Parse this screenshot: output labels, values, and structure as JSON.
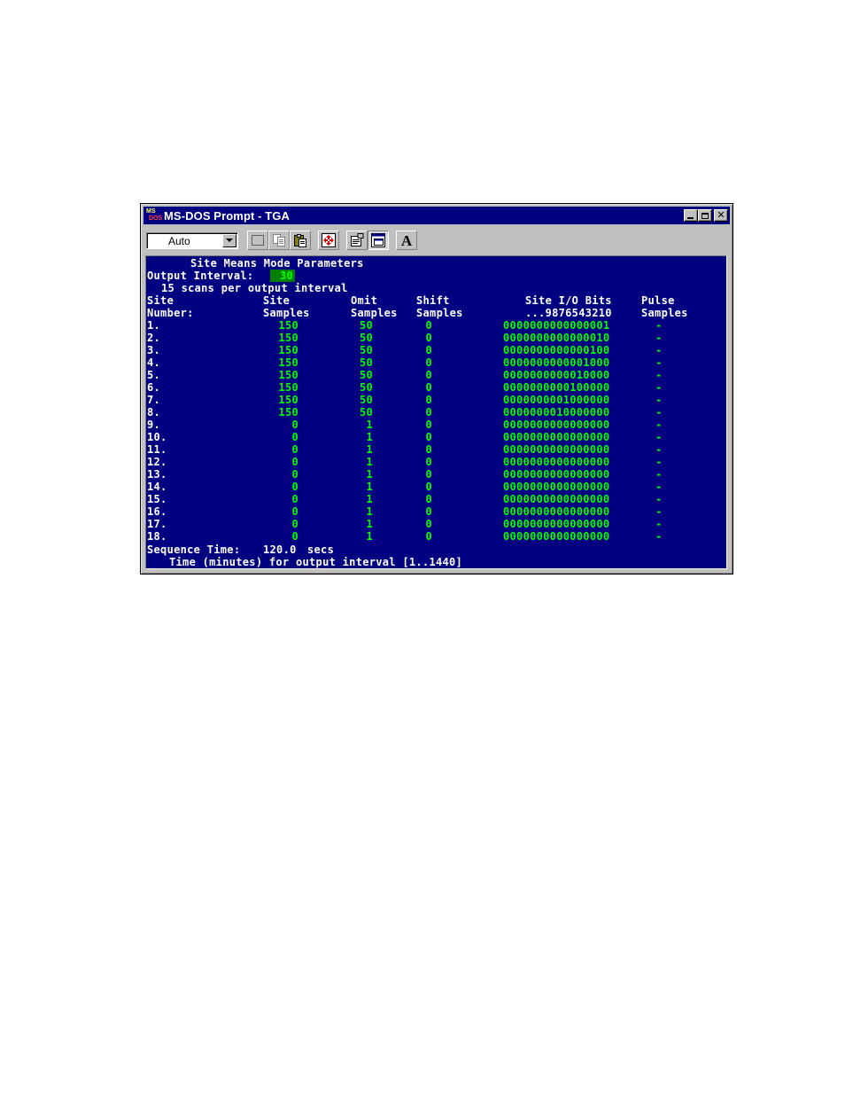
{
  "window": {
    "title": "MS-DOS Prompt - TGA",
    "icon_text_top": "MS",
    "icon_text_bottom": "DOS"
  },
  "toolbar": {
    "font_size_value": "Auto",
    "buttons": [
      "mark-icon",
      "copy-icon",
      "paste-icon",
      "fullscreen-icon",
      "properties-icon",
      "background-icon",
      "font-icon"
    ],
    "font_button_label": "A"
  },
  "console": {
    "heading": "Site Means Mode Parameters",
    "output_interval_label": "Output Interval:",
    "output_interval_value": "30",
    "scans_line": "15 scans per output interval",
    "headers": {
      "site_1": "Site",
      "site_2": "Number:",
      "site_samples_1": "Site",
      "site_samples_2": "Samples",
      "omit_1": "Omit",
      "omit_2": "Samples",
      "shift_1": "Shift",
      "shift_2": "Samples",
      "io_1": "Site I/O Bits",
      "io_2": "...9876543210",
      "pulse_1": "Pulse",
      "pulse_2": "Samples"
    },
    "rows": [
      {
        "site": "1.",
        "samples": "150",
        "omit": "50",
        "shift": "0",
        "bits": "0000000000000001",
        "pulse": "-"
      },
      {
        "site": "2.",
        "samples": "150",
        "omit": "50",
        "shift": "0",
        "bits": "0000000000000010",
        "pulse": "-"
      },
      {
        "site": "3.",
        "samples": "150",
        "omit": "50",
        "shift": "0",
        "bits": "0000000000000100",
        "pulse": "-"
      },
      {
        "site": "4.",
        "samples": "150",
        "omit": "50",
        "shift": "0",
        "bits": "0000000000001000",
        "pulse": "-"
      },
      {
        "site": "5.",
        "samples": "150",
        "omit": "50",
        "shift": "0",
        "bits": "0000000000010000",
        "pulse": "-"
      },
      {
        "site": "6.",
        "samples": "150",
        "omit": "50",
        "shift": "0",
        "bits": "0000000000100000",
        "pulse": "-"
      },
      {
        "site": "7.",
        "samples": "150",
        "omit": "50",
        "shift": "0",
        "bits": "0000000001000000",
        "pulse": "-"
      },
      {
        "site": "8.",
        "samples": "150",
        "omit": "50",
        "shift": "0",
        "bits": "0000000010000000",
        "pulse": "-"
      },
      {
        "site": "9.",
        "samples": "0",
        "omit": "1",
        "shift": "0",
        "bits": "0000000000000000",
        "pulse": "-"
      },
      {
        "site": "10.",
        "samples": "0",
        "omit": "1",
        "shift": "0",
        "bits": "0000000000000000",
        "pulse": "-"
      },
      {
        "site": "11.",
        "samples": "0",
        "omit": "1",
        "shift": "0",
        "bits": "0000000000000000",
        "pulse": "-"
      },
      {
        "site": "12.",
        "samples": "0",
        "omit": "1",
        "shift": "0",
        "bits": "0000000000000000",
        "pulse": "-"
      },
      {
        "site": "13.",
        "samples": "0",
        "omit": "1",
        "shift": "0",
        "bits": "0000000000000000",
        "pulse": "-"
      },
      {
        "site": "14.",
        "samples": "0",
        "omit": "1",
        "shift": "0",
        "bits": "0000000000000000",
        "pulse": "-"
      },
      {
        "site": "15.",
        "samples": "0",
        "omit": "1",
        "shift": "0",
        "bits": "0000000000000000",
        "pulse": "-"
      },
      {
        "site": "16.",
        "samples": "0",
        "omit": "1",
        "shift": "0",
        "bits": "0000000000000000",
        "pulse": "-"
      },
      {
        "site": "17.",
        "samples": "0",
        "omit": "1",
        "shift": "0",
        "bits": "0000000000000000",
        "pulse": "-"
      },
      {
        "site": "18.",
        "samples": "0",
        "omit": "1",
        "shift": "0",
        "bits": "0000000000000000",
        "pulse": "-"
      }
    ],
    "sequence_time_label": "Sequence Time:",
    "sequence_time_value": "120.0",
    "sequence_time_unit": "secs",
    "prompt": "Time (minutes) for output interval [1..1440]"
  },
  "colors": {
    "console_bg": "#000080",
    "text_white": "#ffffff",
    "text_green": "#00ff00",
    "title_bar": "#000080",
    "input_highlight": "#008000"
  }
}
